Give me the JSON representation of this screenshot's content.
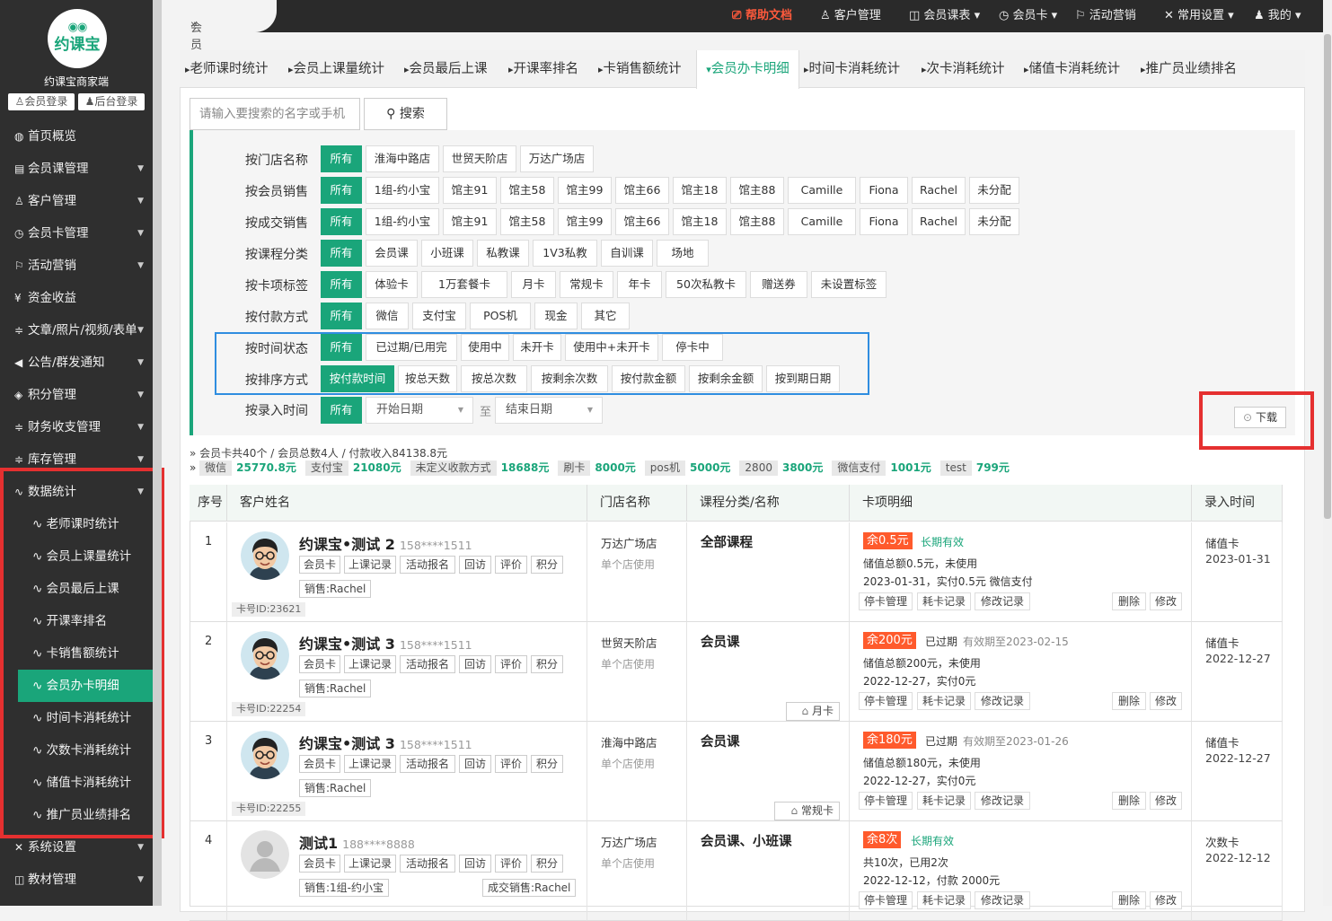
{
  "sidebar": {
    "logo_text": "约课宝",
    "brand": "约课宝商家端",
    "member_login": "会员登录",
    "admin_login": "后台登录",
    "items": [
      {
        "icon": "globe-icon",
        "glyph": "◍",
        "label": "首页概览"
      },
      {
        "icon": "doc-icon",
        "glyph": "▤",
        "label": "会员课管理"
      },
      {
        "icon": "user-icon",
        "glyph": "♙",
        "label": "客户管理"
      },
      {
        "icon": "clock-icon",
        "glyph": "◷",
        "label": "会员卡管理"
      },
      {
        "icon": "flag-icon",
        "glyph": "⚐",
        "label": "活动营销"
      },
      {
        "icon": "yen-icon",
        "glyph": "¥",
        "label": "资金收益"
      },
      {
        "icon": "sliders-icon",
        "glyph": "≑",
        "label": "文章/照片/视频/表单"
      },
      {
        "icon": "speaker-icon",
        "glyph": "◀",
        "label": "公告/群发通知"
      },
      {
        "icon": "diamond-icon",
        "glyph": "◈",
        "label": "积分管理"
      },
      {
        "icon": "sliders-icon",
        "glyph": "≑",
        "label": "财务收支管理"
      },
      {
        "icon": "sliders-icon",
        "glyph": "≑",
        "label": "库存管理"
      },
      {
        "icon": "pulse-icon",
        "glyph": "∿",
        "label": "数据统计"
      }
    ],
    "subitems": [
      "老师课时统计",
      "会员上课量统计",
      "会员最后上课",
      "开课率排名",
      "卡销售额统计",
      "会员办卡明细",
      "时间卡消耗统计",
      "次数卡消耗统计",
      "储值卡消耗统计",
      "推广员业绩排名"
    ],
    "active_sub": "会员办卡明细",
    "bottom_items": [
      {
        "icon": "wrench-icon",
        "glyph": "✕",
        "label": "系统设置"
      },
      {
        "icon": "book-icon",
        "glyph": "◫",
        "label": "教材管理"
      }
    ]
  },
  "topbar": {
    "breadcrumb": "会员办卡明细",
    "links": [
      {
        "icon": "help-icon",
        "label": "帮助文档"
      },
      {
        "icon": "user-icon",
        "label": "客户管理"
      },
      {
        "icon": "book-icon",
        "label": "会员课表"
      },
      {
        "icon": "clock-icon",
        "label": "会员卡"
      },
      {
        "icon": "flag-icon",
        "label": "活动营销"
      },
      {
        "icon": "tools-icon",
        "label": "常用设置"
      },
      {
        "icon": "person-icon",
        "label": "我的"
      }
    ]
  },
  "tabs": [
    "老师课时统计",
    "会员上课量统计",
    "会员最后上课",
    "开课率排名",
    "卡销售额统计",
    "会员办卡明细",
    "时间卡消耗统计",
    "次卡消耗统计",
    "储值卡消耗统计",
    "推广员业绩排名"
  ],
  "active_tab": "会员办卡明细",
  "search": {
    "placeholder": "请输入要搜索的名字或手机",
    "button": "搜索"
  },
  "filters": [
    {
      "label": "按门店名称",
      "options": [
        "所有",
        "淮海中路店",
        "世贸天阶店",
        "万达广场店"
      ]
    },
    {
      "label": "按会员销售",
      "options": [
        "所有",
        "1组-约小宝",
        "馆主91",
        "馆主58",
        "馆主99",
        "馆主66",
        "馆主18",
        "馆主88",
        "Camille",
        "Fiona",
        "Rachel",
        "未分配"
      ]
    },
    {
      "label": "按成交销售",
      "options": [
        "所有",
        "1组-约小宝",
        "馆主91",
        "馆主58",
        "馆主99",
        "馆主66",
        "馆主18",
        "馆主88",
        "Camille",
        "Fiona",
        "Rachel",
        "未分配"
      ]
    },
    {
      "label": "按课程分类",
      "options": [
        "所有",
        "会员课",
        "小班课",
        "私教课",
        "1V3私教",
        "自训课",
        "场地"
      ]
    },
    {
      "label": "按卡项标签",
      "options": [
        "所有",
        "体验卡",
        "1万套餐卡",
        "月卡",
        "常规卡",
        "年卡",
        "50次私教卡",
        "赠送券",
        "未设置标签"
      ]
    },
    {
      "label": "按付款方式",
      "options": [
        "所有",
        "微信",
        "支付宝",
        "POS机",
        "现金",
        "其它"
      ]
    },
    {
      "label": "按时间状态",
      "options": [
        "所有",
        "已过期/已用完",
        "使用中",
        "未开卡",
        "使用中+未开卡",
        "停卡中"
      ]
    },
    {
      "label": "按排序方式",
      "options": [
        "按付款时间",
        "按总天数",
        "按总次数",
        "按剩余次数",
        "按付款金额",
        "按剩余金额",
        "按到期日期"
      ]
    }
  ],
  "entry_time": {
    "label": "按录入时间",
    "all": "所有",
    "start": "开始日期",
    "to": "至",
    "end": "结束日期"
  },
  "download": "下载",
  "summary": {
    "line1": "会员卡共40个 / 会员总数4人 / 付款收入84138.8元",
    "pairs": [
      {
        "k": "微信",
        "v": "25770.8元"
      },
      {
        "k": "支付宝",
        "v": "21080元"
      },
      {
        "k": "未定义收款方式",
        "v": "18688元"
      },
      {
        "k": "刷卡",
        "v": "8000元"
      },
      {
        "k": "pos机",
        "v": "5000元"
      },
      {
        "k": "2800",
        "v": "3800元"
      },
      {
        "k": "微信支付",
        "v": "1001元"
      },
      {
        "k": "test",
        "v": "799元"
      }
    ]
  },
  "table": {
    "headers": [
      "序号",
      "客户姓名",
      "门店名称",
      "课程分类/名称",
      "卡项明细",
      "录入时间"
    ],
    "action_tags": [
      "会员卡",
      "上课记录",
      "活动报名",
      "回访",
      "评价",
      "积分"
    ],
    "card_actions": [
      "停卡管理",
      "耗卡记录",
      "修改记录",
      "删除",
      "修改"
    ],
    "rows": [
      {
        "seq": "1",
        "name": "约课宝•测试 2",
        "phone": "158****1511",
        "sales": "销售:Rachel",
        "deal": "",
        "card_id": "卡号ID:23621",
        "store": "万达广场店",
        "store_note": "单个店使用",
        "course": "全部课程",
        "card_tag": "",
        "remain": "余0.5元",
        "status": "长期有效",
        "status_date": "",
        "line1": "储值总额0.5元，未使用",
        "line2": "2023-01-31，实付0.5元 微信支付",
        "type": "储值卡",
        "date": "2023-01-31",
        "avatar": "cartoon"
      },
      {
        "seq": "2",
        "name": "约课宝•测试 3",
        "phone": "158****1511",
        "sales": "销售:Rachel",
        "deal": "",
        "card_id": "卡号ID:22254",
        "store": "世贸天阶店",
        "store_note": "单个店使用",
        "course": "会员课",
        "card_tag": "月卡",
        "remain": "余200元",
        "status": "已过期",
        "status_date": "有效期至2023-02-15",
        "line1": "储值总额200元，未使用",
        "line2": "2022-12-27，实付0元",
        "type": "储值卡",
        "date": "2022-12-27",
        "avatar": "cartoon"
      },
      {
        "seq": "3",
        "name": "约课宝•测试 3",
        "phone": "158****1511",
        "sales": "销售:Rachel",
        "deal": "",
        "card_id": "卡号ID:22255",
        "store": "淮海中路店",
        "store_note": "单个店使用",
        "course": "会员课",
        "card_tag": "常规卡",
        "remain": "余180元",
        "status": "已过期",
        "status_date": "有效期至2023-01-26",
        "line1": "储值总额180元，未使用",
        "line2": "2022-12-27，实付0元",
        "type": "储值卡",
        "date": "2022-12-27",
        "avatar": "cartoon"
      },
      {
        "seq": "4",
        "name": "测试1",
        "phone": "188****8888",
        "sales": "销售:1组-约小宝",
        "deal": "成交销售:Rachel",
        "card_id": "",
        "store": "万达广场店",
        "store_note": "单个店使用",
        "course": "会员课、小班课",
        "card_tag": "",
        "remain": "余8次",
        "status": "长期有效",
        "status_date": "",
        "line1": "共10次，已用2次",
        "line2": "2022-12-12，付款 2000元",
        "type": "次数卡",
        "date": "2022-12-12",
        "avatar": "default"
      }
    ]
  },
  "colors": {
    "accent": "#1aa57a",
    "highlight_red": "#e53030",
    "highlight_blue": "#2f8de0",
    "badge": "#ff5a2c"
  }
}
